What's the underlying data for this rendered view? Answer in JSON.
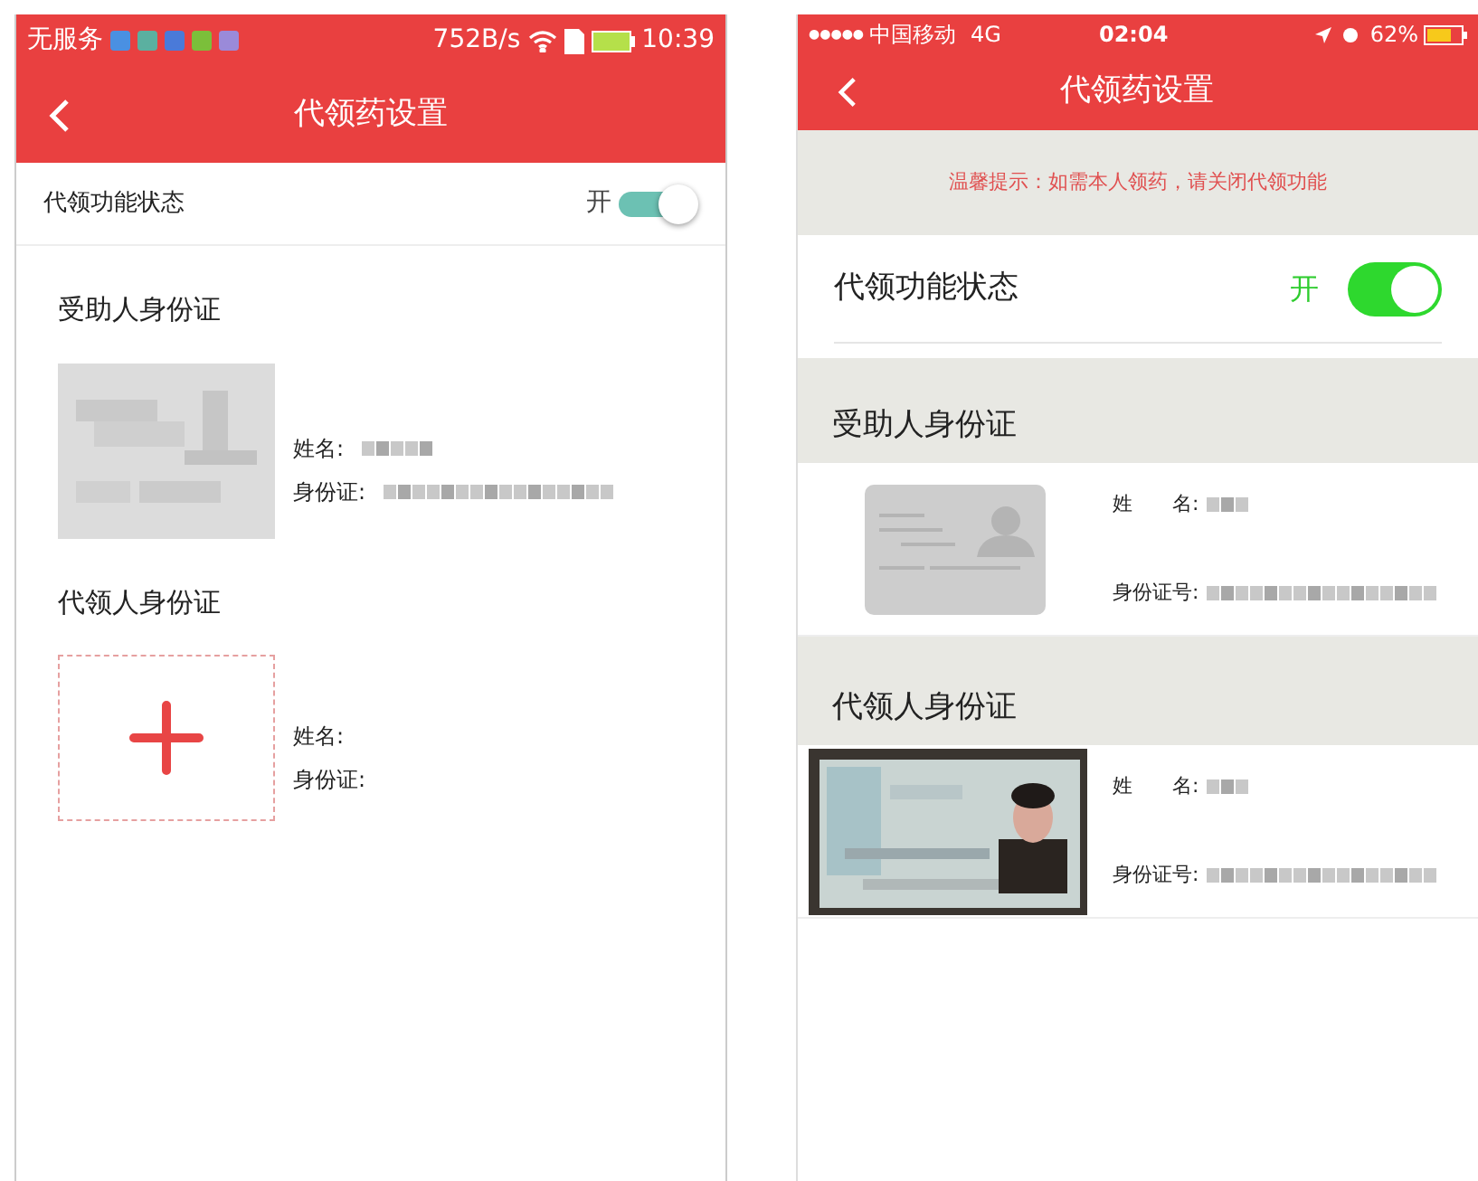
{
  "screens": [
    {
      "kind": "android",
      "status_bar": {
        "carrier": "无服务",
        "speed": "752B/s",
        "time": "10:39"
      },
      "nav": {
        "title": "代领药设置"
      },
      "toggle": {
        "label": "代领功能状态",
        "state_text": "开",
        "on": true
      },
      "sections": [
        {
          "title": "受助人身份证",
          "card": {
            "kind": "blurred"
          },
          "fields": [
            {
              "label": "姓名:",
              "redacted": true
            },
            {
              "label": "身份证:",
              "redacted": true
            }
          ]
        },
        {
          "title": "代领人身份证",
          "card": {
            "kind": "add"
          },
          "fields": [
            {
              "label": "姓名:",
              "redacted": false
            },
            {
              "label": "身份证:",
              "redacted": false
            }
          ]
        }
      ]
    },
    {
      "kind": "ios",
      "status_bar": {
        "signal": "●●●●●",
        "carrier": "中国移动",
        "network": "4G",
        "time": "02:04",
        "battery": "62%"
      },
      "nav": {
        "title": "代领药设置"
      },
      "notice": "温馨提示：如需本人领药，请关闭代领功能",
      "toggle": {
        "label": "代领功能状态",
        "state_text": "开",
        "on": true
      },
      "sections": [
        {
          "title": "受助人身份证",
          "card": {
            "kind": "placeholder"
          },
          "fields": [
            {
              "label": "姓　　名:",
              "redacted": true
            },
            {
              "label": "身份证号:",
              "redacted": true
            }
          ]
        },
        {
          "title": "代领人身份证",
          "fields": [
            {
              "label": "姓　　名:",
              "redacted": true
            },
            {
              "label": "身份证号:",
              "redacted": true
            }
          ]
        }
      ]
    }
  ]
}
